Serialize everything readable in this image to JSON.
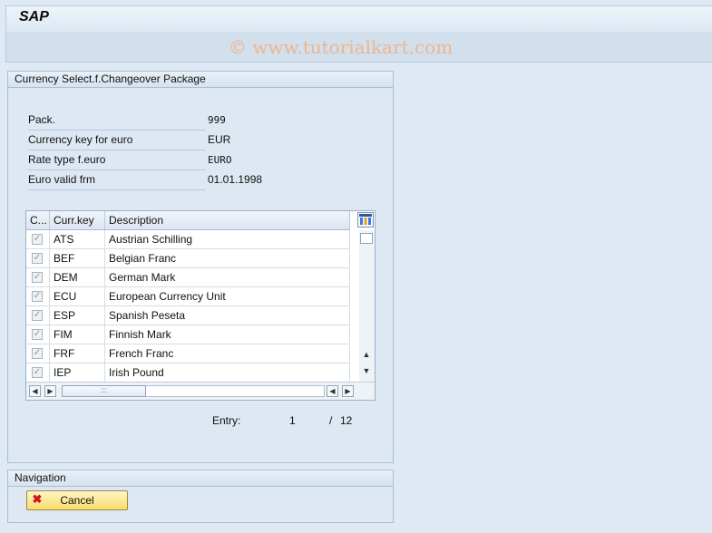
{
  "app": {
    "title": "SAP",
    "watermark": "© www.tutorialkart.com"
  },
  "main_group": {
    "title": "Currency Select.f.Changeover Package",
    "fields": [
      {
        "label": "Pack.",
        "value": "999"
      },
      {
        "label": "Currency key for euro",
        "value": "EUR"
      },
      {
        "label": "Rate type f.euro",
        "value": "EURO"
      },
      {
        "label": "Euro valid frm",
        "value": "01.01.1998"
      }
    ]
  },
  "table": {
    "columns": [
      "C...",
      "Curr.key",
      "Description"
    ],
    "rows": [
      {
        "checked": true,
        "key": "ATS",
        "desc": "Austrian Schilling"
      },
      {
        "checked": true,
        "key": "BEF",
        "desc": "Belgian Franc"
      },
      {
        "checked": true,
        "key": "DEM",
        "desc": "German Mark"
      },
      {
        "checked": true,
        "key": "ECU",
        "desc": "European Currency Unit"
      },
      {
        "checked": true,
        "key": "ESP",
        "desc": "Spanish Peseta"
      },
      {
        "checked": true,
        "key": "FIM",
        "desc": "Finnish Mark"
      },
      {
        "checked": true,
        "key": "FRF",
        "desc": "French Franc"
      },
      {
        "checked": true,
        "key": "IEP",
        "desc": "Irish Pound"
      }
    ],
    "hscroll_grip": ":::"
  },
  "entry": {
    "label": "Entry:",
    "current": "1",
    "separator": "/",
    "total": "12"
  },
  "navigation": {
    "title": "Navigation",
    "cancel_label": "Cancel"
  },
  "icons": {
    "check": "✓",
    "cancel": "✖",
    "up": "▲",
    "down": "▼",
    "left": "◀",
    "right": "▶"
  }
}
